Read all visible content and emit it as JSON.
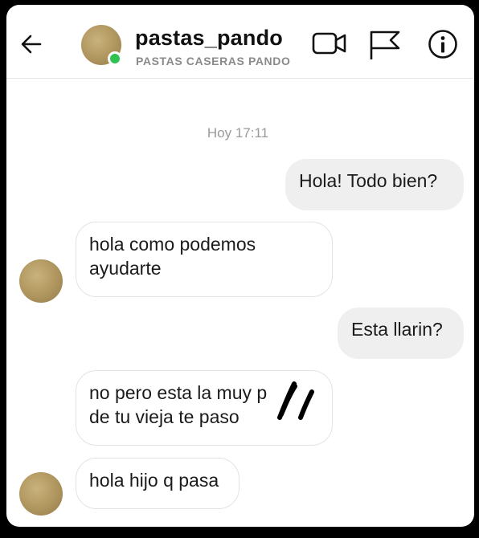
{
  "header": {
    "username": "pastas_pando",
    "subtitle": "PASTAS CASERAS PANDO",
    "online": true,
    "icons": [
      "back-arrow-icon",
      "video-call-icon",
      "flag-icon",
      "info-icon"
    ]
  },
  "chat": {
    "timestamp": "Hoy 17:11",
    "messages": [
      {
        "from": "me",
        "text": "Hola! Todo bien?"
      },
      {
        "from": "them",
        "line1": "hola como podemos",
        "line2": "ayudarte"
      },
      {
        "from": "me",
        "text": "Esta llarin?"
      },
      {
        "from": "them",
        "line1": "no pero esta la muy p",
        "line2": "de tu vieja te paso",
        "redacted": true
      },
      {
        "from": "them",
        "text": "hola hijo q pasa"
      }
    ]
  },
  "colors": {
    "outgoing_bubble": "#efefef",
    "incoming_border": "#e3e3e3",
    "online": "#2fc152",
    "timestamp": "#9a9a9a"
  }
}
